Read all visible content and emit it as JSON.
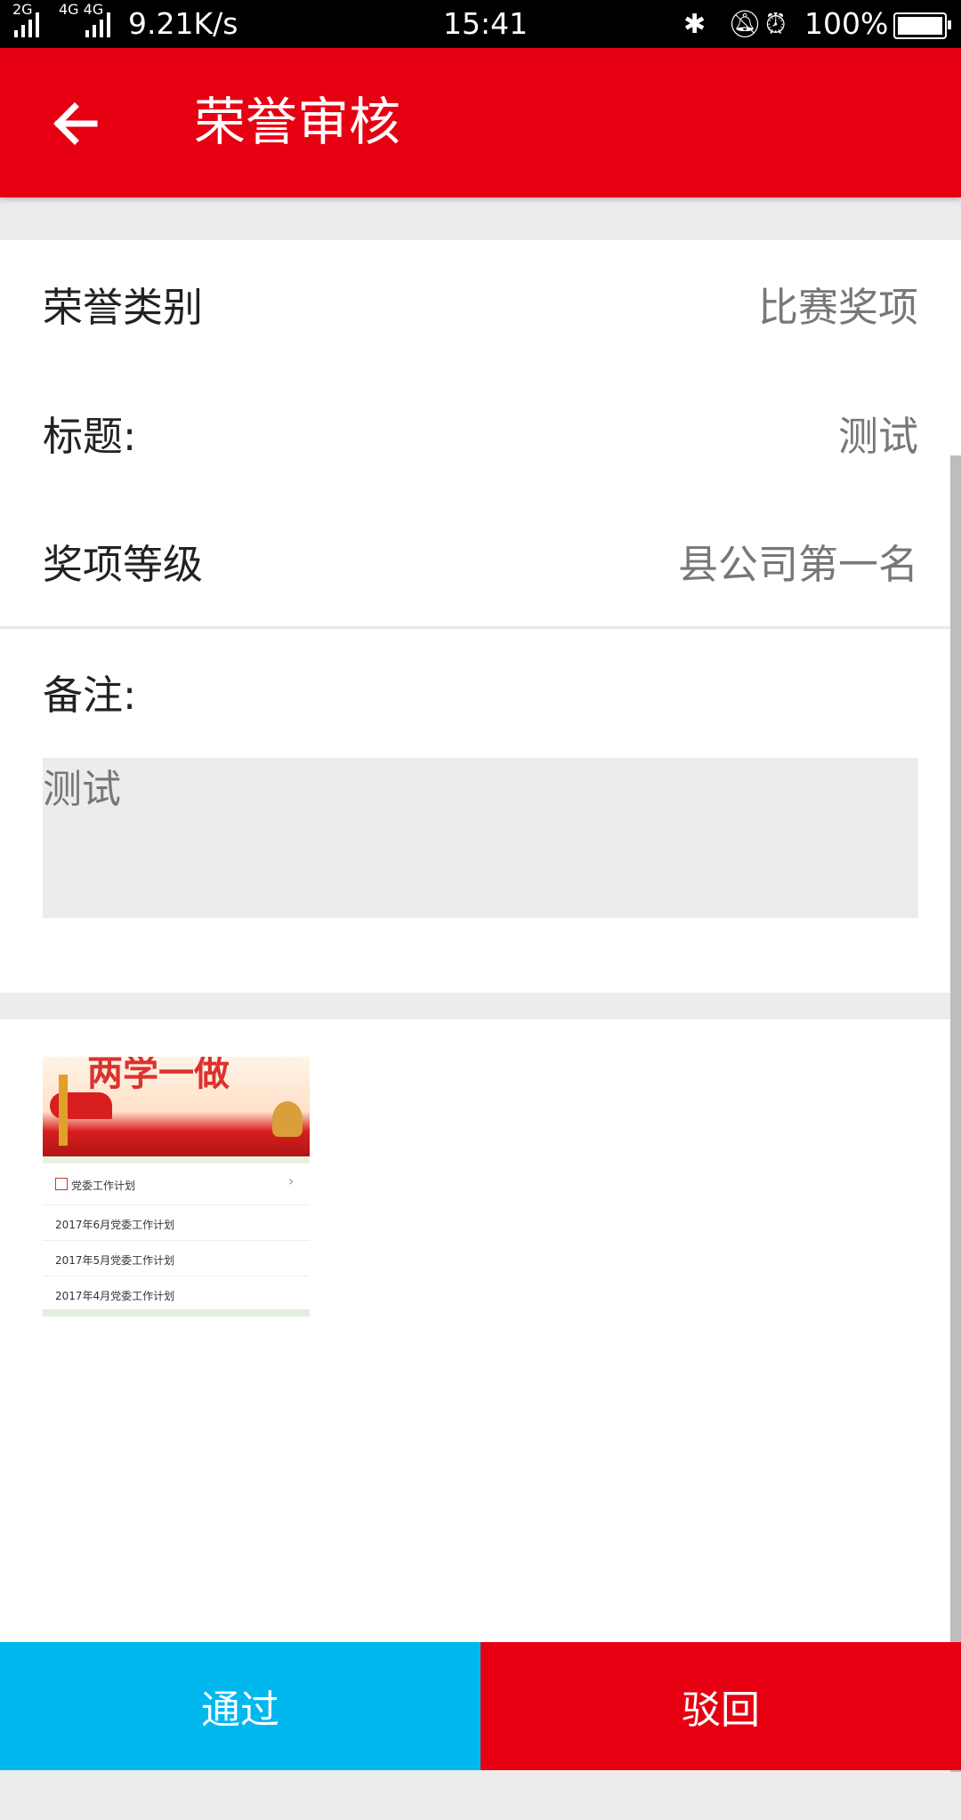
{
  "status_bar": {
    "network_left": "2G",
    "network_mid": "4G 4G",
    "speed": "9.21K/s",
    "time": "15:41",
    "battery": "100%",
    "icons": [
      "signal-icon",
      "bluetooth-icon",
      "mute-icon",
      "alarm-icon",
      "battery-icon"
    ]
  },
  "app_bar": {
    "title": "荣誉审核",
    "back_icon": "back-arrow-icon",
    "color": "#e60012"
  },
  "form": {
    "category_label": "荣誉类别",
    "category_value": "比赛奖项",
    "title_label": "标题:",
    "title_value": "测试",
    "level_label": "奖项等级",
    "level_value": "县公司第一名",
    "remark_label": "备注:",
    "remark_value": "测试"
  },
  "attachment": {
    "banner_text": "两学一做",
    "list_header": "党委工作计划",
    "items": [
      "2017年6月党委工作计划",
      "2017年5月党委工作计划",
      "2017年4月党委工作计划"
    ]
  },
  "actions": {
    "approve_label": "通过",
    "reject_label": "驳回",
    "approve_color": "#00b7ee",
    "reject_color": "#e60012"
  }
}
